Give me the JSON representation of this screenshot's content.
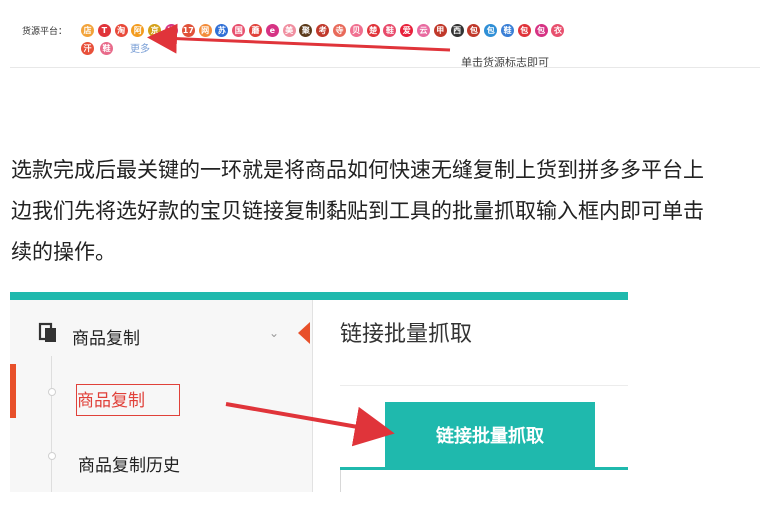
{
  "source_bar": {
    "label": "货源平台：",
    "icons": [
      {
        "name": "source-icon-1",
        "glyph": "店",
        "color": "#f2a33a"
      },
      {
        "name": "source-icon-2",
        "glyph": "T",
        "color": "#e0343a"
      },
      {
        "name": "source-icon-3",
        "glyph": "淘",
        "color": "#e84a3a"
      },
      {
        "name": "source-icon-4",
        "glyph": "阿",
        "color": "#f39c1f"
      },
      {
        "name": "source-icon-5",
        "glyph": "京",
        "color": "#d4a017"
      },
      {
        "name": "source-icon-6",
        "glyph": "唯",
        "color": "#d63384"
      },
      {
        "name": "source-icon-7",
        "glyph": "17",
        "color": "#e0523a"
      },
      {
        "name": "source-icon-8",
        "glyph": "网",
        "color": "#f28c3a"
      },
      {
        "name": "source-icon-9",
        "glyph": "苏",
        "color": "#2f6fd6"
      },
      {
        "name": "source-icon-10",
        "glyph": "国",
        "color": "#e8506e"
      },
      {
        "name": "source-icon-11",
        "glyph": "蘑",
        "color": "#e0413a"
      },
      {
        "name": "source-icon-12",
        "glyph": "e",
        "color": "#d63384"
      },
      {
        "name": "source-icon-13",
        "glyph": "美",
        "color": "#f08fa0"
      },
      {
        "name": "source-icon-14",
        "glyph": "聚",
        "color": "#5a3a1a"
      },
      {
        "name": "source-icon-15",
        "glyph": "考",
        "color": "#c0392b"
      },
      {
        "name": "source-icon-16",
        "glyph": "寺",
        "color": "#e86a5a"
      },
      {
        "name": "source-icon-17",
        "glyph": "贝",
        "color": "#f07090"
      },
      {
        "name": "source-icon-18",
        "glyph": "楚",
        "color": "#e0343a"
      },
      {
        "name": "source-icon-19",
        "glyph": "鞋",
        "color": "#e84a6a"
      },
      {
        "name": "source-icon-20",
        "glyph": "爱",
        "color": "#e8203a"
      },
      {
        "name": "source-icon-21",
        "glyph": "云",
        "color": "#e86aa0"
      },
      {
        "name": "source-icon-22",
        "glyph": "甲",
        "color": "#c0392b"
      },
      {
        "name": "source-icon-23",
        "glyph": "西",
        "color": "#333333"
      },
      {
        "name": "source-icon-24",
        "glyph": "包",
        "color": "#c0392b"
      },
      {
        "name": "source-icon-25",
        "glyph": "包",
        "color": "#2f8fd6"
      },
      {
        "name": "source-icon-26",
        "glyph": "鞋",
        "color": "#3a7fd6"
      },
      {
        "name": "source-icon-27",
        "glyph": "包",
        "color": "#e0343a"
      },
      {
        "name": "source-icon-28",
        "glyph": "包",
        "color": "#d63384"
      },
      {
        "name": "source-icon-29",
        "glyph": "衣",
        "color": "#e8506e"
      },
      {
        "name": "source-icon-30",
        "glyph": "汗",
        "color": "#e8503a"
      },
      {
        "name": "source-icon-31",
        "glyph": "鞋",
        "color": "#e86a8a"
      }
    ],
    "more": "更多",
    "hint": "单击货源标志即可",
    "arrow_color": "#e0343a"
  },
  "paragraph": {
    "lines": [
      "选款完成后最关键的一环就是将商品如何快速无缝复制上货到拼多多平台上",
      "边我们先将选好款的宝贝链接复制黏贴到工具的批量抓取输入框内即可单击",
      "续的操作。"
    ]
  },
  "embed": {
    "sidebar": {
      "menu_title": "商品复制",
      "chevron": "⌄",
      "items": [
        {
          "label": "商品复制",
          "active": true
        },
        {
          "label": "商品复制历史",
          "active": false
        }
      ]
    },
    "content": {
      "title": "链接批量抓取",
      "fetch_button": "链接批量抓取"
    },
    "accent_color": "#1fb9ad",
    "highlight_color": "#e0413a"
  }
}
